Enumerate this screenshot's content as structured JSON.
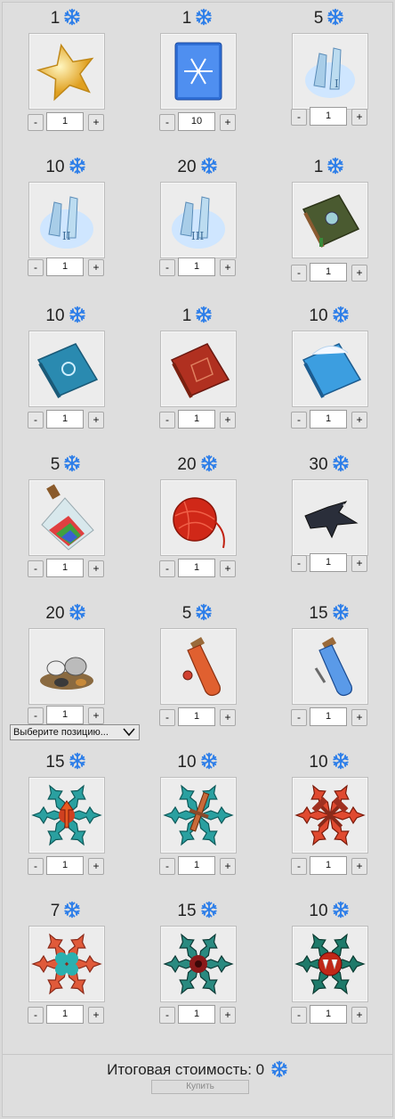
{
  "currency": {
    "icon": "snowflake-icon",
    "color": "#2b7de9"
  },
  "items": [
    {
      "price": "1",
      "qty": "1",
      "icon": "gold-star-icon"
    },
    {
      "price": "1",
      "qty": "10",
      "icon": "snow-scroll-icon"
    },
    {
      "price": "5",
      "qty": "1",
      "icon": "frost-rune-i-icon"
    },
    {
      "price": "10",
      "qty": "1",
      "icon": "frost-rune-ii-icon"
    },
    {
      "price": "20",
      "qty": "1",
      "icon": "frost-rune-iii-icon"
    },
    {
      "price": "1",
      "qty": "1",
      "icon": "green-tome-icon"
    },
    {
      "price": "10",
      "qty": "1",
      "icon": "blue-snowflake-tome-icon"
    },
    {
      "price": "1",
      "qty": "1",
      "icon": "red-tome-icon"
    },
    {
      "price": "10",
      "qty": "1",
      "icon": "ice-tome-icon"
    },
    {
      "price": "5",
      "qty": "1",
      "icon": "rainbow-potion-icon"
    },
    {
      "price": "20",
      "qty": "1",
      "icon": "red-yarn-ball-icon"
    },
    {
      "price": "30",
      "qty": "1",
      "icon": "raven-icon"
    },
    {
      "price": "20",
      "qty": "1",
      "icon": "animals-icon"
    },
    {
      "price": "5",
      "qty": "1",
      "icon": "red-vial-icon"
    },
    {
      "price": "15",
      "qty": "1",
      "icon": "blue-vial-icon"
    },
    {
      "price": "15",
      "qty": "1",
      "icon": "snowflake-arrow-icon"
    },
    {
      "price": "10",
      "qty": "1",
      "icon": "snowflake-sword-icon"
    },
    {
      "price": "10",
      "qty": "1",
      "icon": "snowflake-hammers-icon"
    },
    {
      "price": "7",
      "qty": "1",
      "icon": "snowflake-clover-icon"
    },
    {
      "price": "15",
      "qty": "1",
      "icon": "snowflake-dark-icon"
    },
    {
      "price": "10",
      "qty": "1",
      "icon": "snowflake-fangs-icon"
    }
  ],
  "controls": {
    "minus": "-",
    "plus": "+"
  },
  "select": {
    "value": "Выберите позицию..."
  },
  "footer": {
    "total_label": "Итоговая стоимость:",
    "total_value": "0",
    "buy_label": "Купить"
  }
}
